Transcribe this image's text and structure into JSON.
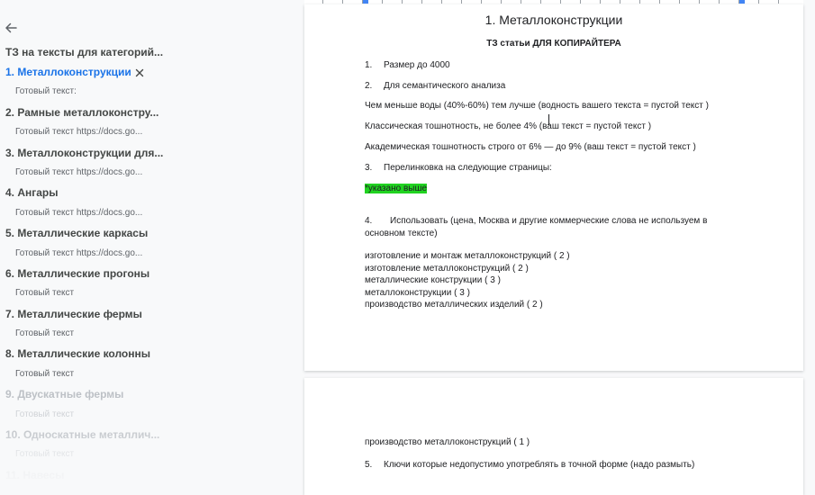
{
  "sidebar": {
    "title": "ТЗ на тексты для категорий...",
    "items": [
      {
        "label": "1. Металлоконструкции",
        "type": "heading",
        "state": "active"
      },
      {
        "label": "Готовый текст:",
        "type": "sub",
        "state": "normal"
      },
      {
        "label": "2. Рамные металлоконстру...",
        "type": "heading",
        "state": "normal"
      },
      {
        "label": "Готовый текст https://docs.go...",
        "type": "sub",
        "state": "normal"
      },
      {
        "label": "3. Металлоконструкции для...",
        "type": "heading",
        "state": "normal"
      },
      {
        "label": "Готовый текст https://docs.go...",
        "type": "sub",
        "state": "normal"
      },
      {
        "label": "4. Ангары",
        "type": "heading",
        "state": "normal"
      },
      {
        "label": "Готовый текст https://docs.go...",
        "type": "sub",
        "state": "normal"
      },
      {
        "label": "5. Металлические каркасы",
        "type": "heading",
        "state": "normal"
      },
      {
        "label": "Готовый текст https://docs.go...",
        "type": "sub",
        "state": "normal"
      },
      {
        "label": "6. Металлические прогоны",
        "type": "heading",
        "state": "normal"
      },
      {
        "label": "Готовый текст",
        "type": "sub",
        "state": "normal"
      },
      {
        "label": "7. Металлические фермы",
        "type": "heading",
        "state": "normal"
      },
      {
        "label": "Готовый текст",
        "type": "sub",
        "state": "normal"
      },
      {
        "label": "8. Металлические колонны",
        "type": "heading",
        "state": "normal"
      },
      {
        "label": "Готовый текст",
        "type": "sub",
        "state": "normal"
      },
      {
        "label": "9. Двускатные фермы",
        "type": "heading",
        "state": "faded"
      },
      {
        "label": "Готовый текст",
        "type": "sub",
        "state": "faded"
      },
      {
        "label": "10. Односкатные металлич...",
        "type": "heading",
        "state": "faded"
      },
      {
        "label": "Готовый текст",
        "type": "sub",
        "state": "faded"
      },
      {
        "label": "11. Навесы",
        "type": "heading",
        "state": "faded2"
      }
    ]
  },
  "document": {
    "title": "1. Металлоконструкции",
    "subtitle": "ТЗ статьи ДЛЯ КОПИРАЙТЕРА",
    "list1_num": "1.",
    "list1_text": "Размер до 4000",
    "list2_num": "2.",
    "list2_text": "Для семантического анализа",
    "water": " Чем меньше воды (40%-60%) тем лучше  (водность вашего текста = пустой текст )",
    "classic": "Классическая тошнотность, не более 4%  (ваш текст = пустой текст )",
    "academic": "Академическая тошнотность строго от 6% — до 9%  (ваш текст = пустой текст )",
    "list3_num": "3.",
    "list3_text": "Перелинковка на следующие страницы:",
    "highlight_text": "*указано выше",
    "list4_num": "4.",
    "list4_text": "Использовать (цена, Москва и другие коммерческие слова не используем в основном тексте)",
    "keywords": [
      "изготовление  и  монтаж  металлоконструкций ( 2 )",
      "изготовление  металлоконструкций ( 2 )",
      "металлические  конструкции ( 3 )",
      "металлоконструкции ( 3 )",
      "производство  металлических  изделий ( 2 )"
    ],
    "page2_keyword": "производство  металлоконструкций ( 1 )",
    "list5_num": "5.",
    "list5_text": "Ключи которые недопустимо употреблять в точной форме (надо размыть)"
  },
  "colors": {
    "active_heading": "#1a73e8",
    "highlight": "#21d321",
    "page_bg": "#ffffff",
    "canvas_bg": "#f8f9fa"
  }
}
